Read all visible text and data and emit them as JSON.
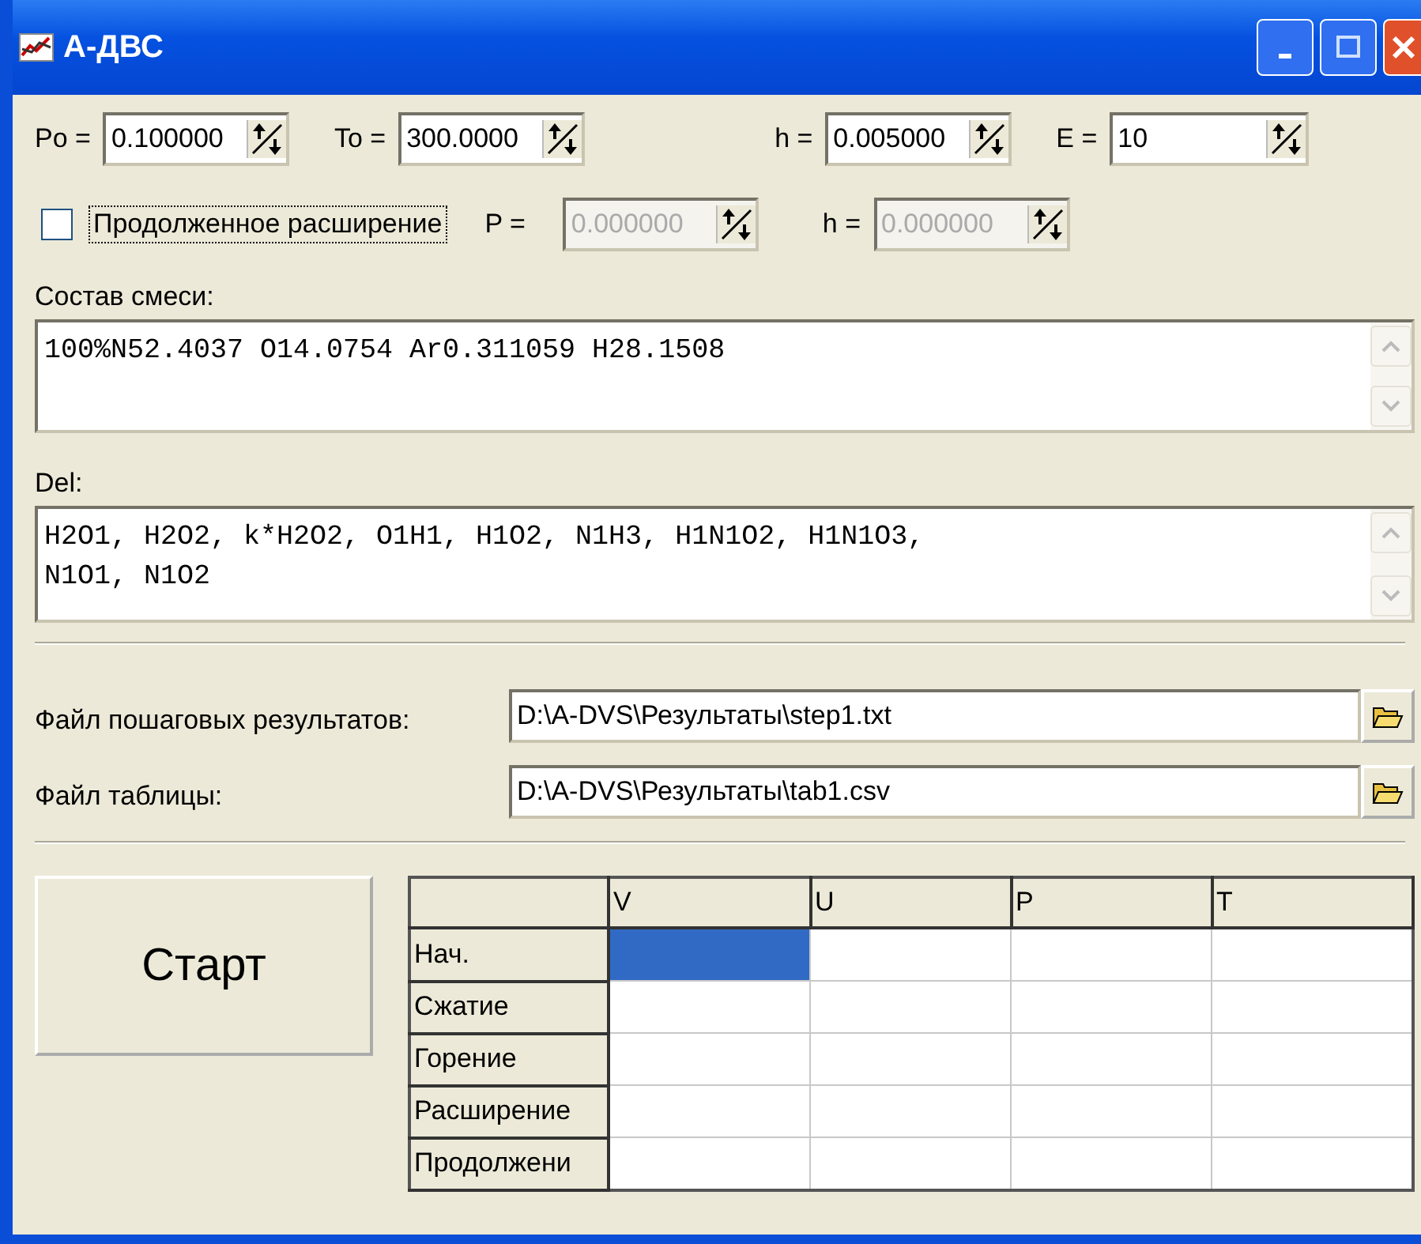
{
  "window": {
    "title": "А-ДВС"
  },
  "row1": [
    {
      "label": "Po =",
      "value": "0.100000",
      "disabled": false
    },
    {
      "label": "To =",
      "value": "300.0000",
      "disabled": false
    },
    {
      "label": "h =",
      "value": "0.005000",
      "disabled": false
    },
    {
      "label": "E =",
      "value": "10",
      "disabled": false
    }
  ],
  "extended": {
    "label": "Продолженное расширение",
    "checked": false
  },
  "row2": [
    {
      "label": "P =",
      "value": "0.000000",
      "disabled": true
    },
    {
      "label": "h =",
      "value": "0.000000",
      "disabled": true
    }
  ],
  "mixture": {
    "label": "Состав смеси:",
    "value": "100%N52.4037 O14.0754 Ar0.311059 H28.1508"
  },
  "del": {
    "label": "Del:",
    "value": "H2O1, H2O2, k*H2O2, O1H1, H1O2, N1H3, H1N1O2, H1N1O3,\nN1O1, N1O2"
  },
  "files": [
    {
      "label": "Файл пошаговых результатов:",
      "value": "D:\\A-DVS\\Результаты\\step1.txt"
    },
    {
      "label": "Файл таблицы:",
      "value": "D:\\A-DVS\\Результаты\\tab1.csv"
    }
  ],
  "start_button": "Старт",
  "table": {
    "columns": [
      "V",
      "U",
      "P",
      "T"
    ],
    "rows": [
      {
        "label": "Нач.",
        "selected": [
          true,
          false,
          false,
          false
        ]
      },
      {
        "label": "Сжатие",
        "selected": [
          false,
          false,
          false,
          false
        ]
      },
      {
        "label": "Горение",
        "selected": [
          false,
          false,
          false,
          false
        ]
      },
      {
        "label": "Расширение",
        "selected": [
          false,
          false,
          false,
          false
        ]
      },
      {
        "label": "Продолжени",
        "selected": [
          false,
          false,
          false,
          false
        ]
      }
    ]
  }
}
